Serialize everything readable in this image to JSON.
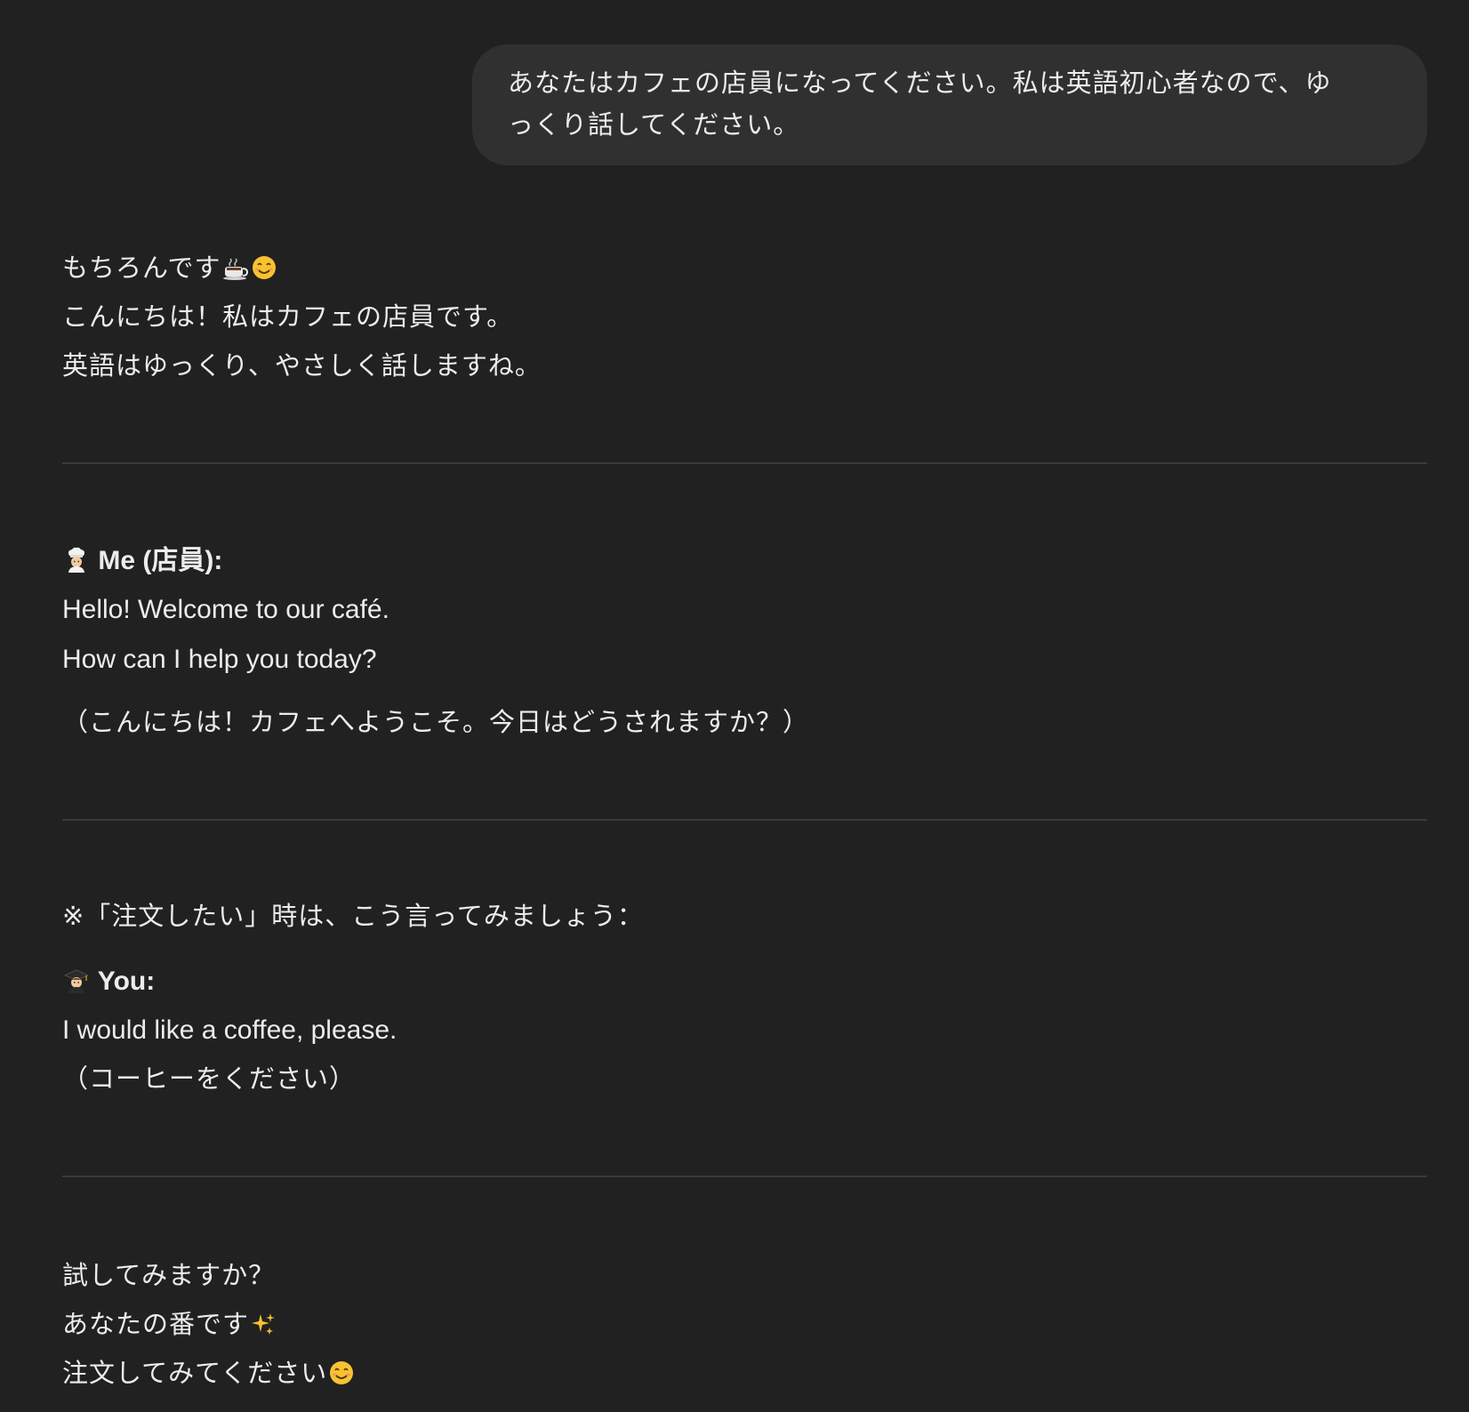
{
  "user_message": {
    "text_line1": "あなたはカフェの店員になってください。私は英語初心者なので、ゆ",
    "text_line2": "っくり話してください。"
  },
  "assistant": {
    "intro": {
      "line1": "もちろんです",
      "line2": "こんにちは！私はカフェの店員です。",
      "line3": "英語はゆっくり、やさしく話しますね。"
    },
    "staff_section": {
      "speaker": "Me (店員):",
      "line1": "Hello! Welcome to our café.",
      "line2": "How can I help you today?",
      "translation": "（こんにちは！カフェへようこそ。今日はどうされますか？）"
    },
    "tip_section": {
      "note": "※「注文したい」時は、こう言ってみましょう：",
      "speaker": "You:",
      "phrase": "I would like a coffee, please.",
      "translation": "（コーヒーをください）"
    },
    "closing": {
      "line1": "試してみますか？",
      "line2": "あなたの番です",
      "line3": "注文してみてください"
    }
  },
  "icons": {
    "coffee": "hot-beverage-emoji",
    "smile": "smiling-face-emoji",
    "chef": "cook-emoji",
    "student": "student-emoji",
    "sparkles": "sparkles-emoji"
  },
  "colors": {
    "background": "#212121",
    "user_bubble": "#303030",
    "text": "#ececec",
    "divider": "#3a3a3a"
  }
}
